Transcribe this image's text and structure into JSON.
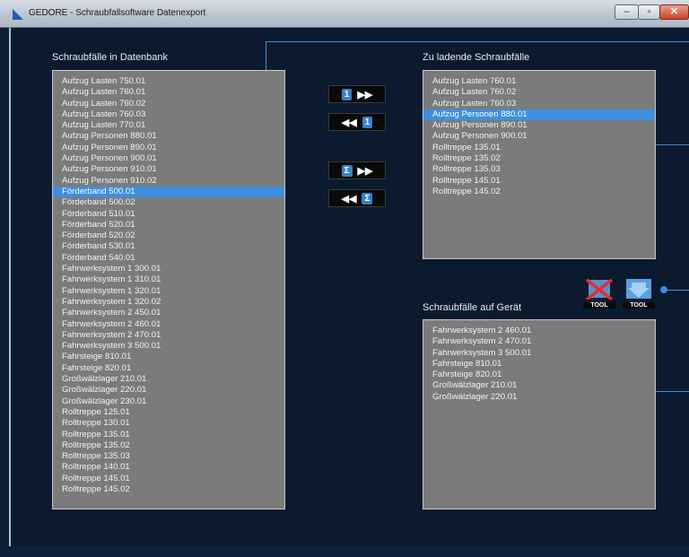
{
  "window": {
    "title": "GEDORE - Schraubfallsoftware Datenexport",
    "min_label": "–",
    "max_label": "▫",
    "close_label": "✕"
  },
  "database": {
    "label": "Schraubfälle in Datenbank",
    "selected_index": 10,
    "items": [
      "Aufzug Lasten 750.01",
      "Aufzug Lasten 760.01",
      "Aufzug Lasten 760.02",
      "Aufzug Lasten 760.03",
      "Aufzug Lasten 770.01",
      "Aufzug Personen 880.01",
      "Aufzug Personen 890.01",
      "Aufzug Personen 900.01",
      "Aufzug Personen 910.01",
      "Aufzug Personen 910.02",
      "Förderband 500.01",
      "Förderband 500.02",
      "Förderband 510.01",
      "Förderband 520.01",
      "Förderband 520.02",
      "Förderband 530.01",
      "Förderband 540.01",
      "Fahrwerksystem 1 300.01",
      "Fahrwerksystem 1 310.01",
      "Fahrwerksystem 1 320.01",
      "Fahrwerksystem 1 320.02",
      "Fahrwerksystem 2 450.01",
      "Fahrwerksystem 2 460.01",
      "Fahrwerksystem 2 470.01",
      "Fahrwerksystem 3 500.01",
      "Fahrsteige 810.01",
      "Fahrsteige 820.01",
      "Großwälzlager 210.01",
      "Großwälzlager 220.01",
      "Großwälzlager 230.01",
      "Rolltreppe 125.01",
      "Rolltreppe 130.01",
      "Rolltreppe 135.01",
      "Rolltreppe 135.02",
      "Rolltreppe 135.03",
      "Rolltreppe 140.01",
      "Rolltreppe 145.01",
      "Rolltreppe 145.02"
    ]
  },
  "to_load": {
    "label": "Zu ladende Schraubfälle",
    "selected_index": 3,
    "items": [
      "Aufzug Lasten 760.01",
      "Aufzug Lasten 760.02",
      "Aufzug Lasten 760.03",
      "Aufzug Personen 880.01",
      "Aufzug Personen 890.01",
      "Aufzug Personen 900.01",
      "Rolltreppe 135.01",
      "Rolltreppe 135.02",
      "Rolltreppe 135.03",
      "Rolltreppe 145.01",
      "Rolltreppe 145.02"
    ]
  },
  "on_device": {
    "label": "Schraubfälle auf Gerät",
    "items": [
      "Fahrwerksystem 2 460.01",
      "Fahrwerksystem 2 470.01",
      "Fahrwerksystem 3 500.01",
      "Fahrsteige 810.01",
      "Fahrsteige 820.01",
      "Großwälzlager 210.01",
      "Großwälzlager 220.01"
    ]
  },
  "controls": {
    "add_one": {
      "chip": "1",
      "arrows": "▶▶"
    },
    "remove_one": {
      "chip": "1",
      "arrows": "◀◀"
    },
    "add_all": {
      "chip": "Σ",
      "arrows": "▶▶"
    },
    "remove_all": {
      "chip": "Σ",
      "arrows": "◀◀"
    }
  },
  "tools": {
    "delete_label": "TOOL",
    "transfer_label": "TOOL"
  },
  "colors": {
    "background": "#0b1a2e",
    "list_bg": "#7b7b7b",
    "selection": "#3d8fdf",
    "accent": "#3a8fe0"
  }
}
